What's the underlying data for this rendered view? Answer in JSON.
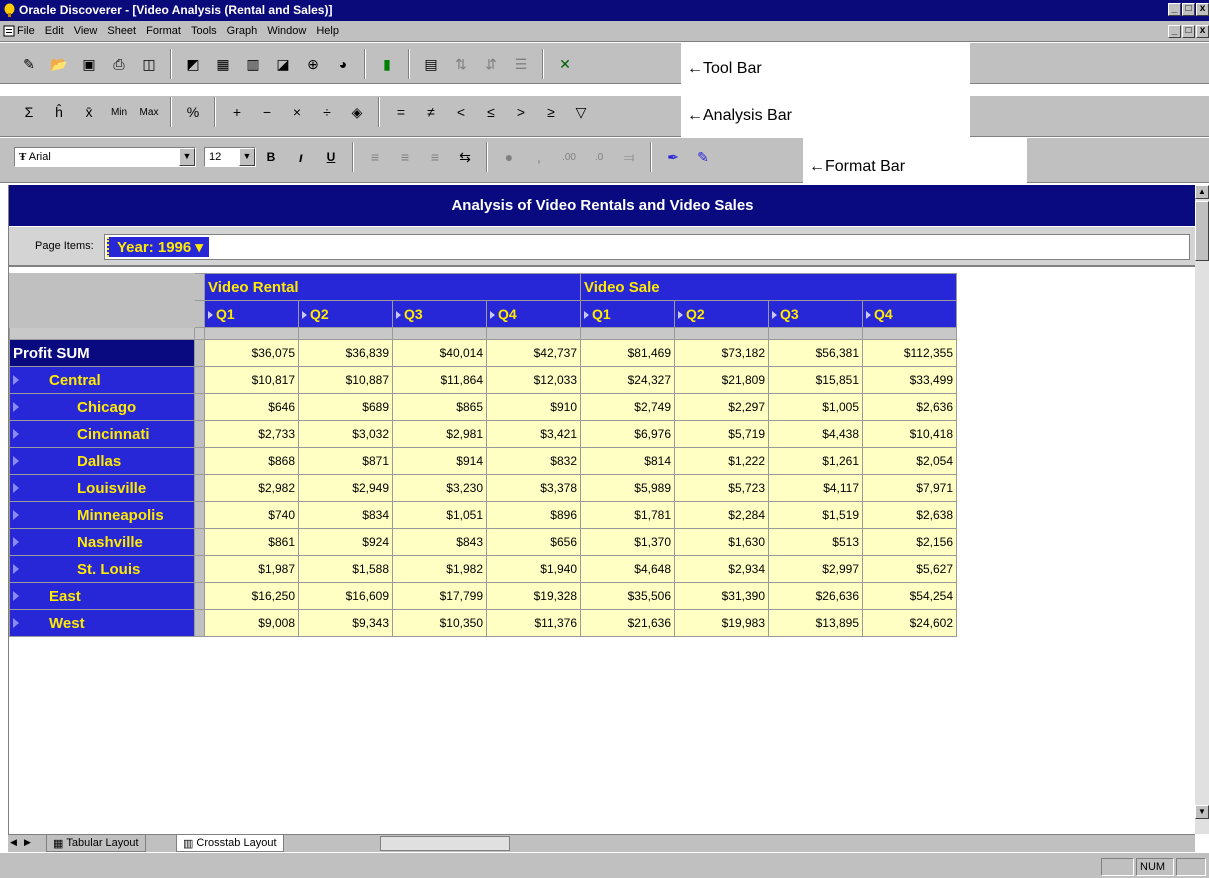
{
  "window": {
    "title": "Oracle Discoverer - [Video Analysis (Rental and Sales)]",
    "controls": [
      "_",
      "&#x25A1;",
      "x"
    ]
  },
  "menu": [
    "File",
    "Edit",
    "View",
    "Sheet",
    "Format",
    "Tools",
    "Graph",
    "Window",
    "Help"
  ],
  "callouts": {
    "toolbar": "←Tool Bar",
    "analysis": "←Analysis Bar",
    "format": "←Format Bar"
  },
  "analysis_bar": {
    "sum": "Σ",
    "count": "ĥ",
    "avg": "x̄",
    "min": "Min",
    "max": "Max",
    "pct": "%",
    "plus": "+",
    "minus": "−",
    "times": "×",
    "divide": "÷",
    "eq": "=",
    "neq": "≠",
    "lt": "<",
    "le": "≤",
    "gt": ">",
    "ge": "≥"
  },
  "format_bar": {
    "font": "Arial",
    "size": "12",
    "bold": "B",
    "italic": "ı",
    "underline": "U"
  },
  "sheet": {
    "title": "Analysis of Video Rentals and Video Sales",
    "page_items_label": "Page Items:",
    "page_item": "Year: 1996 ▾",
    "col_groups": [
      "Video Rental",
      "Video Sale"
    ],
    "quarters": [
      "Q1",
      "Q2",
      "Q3",
      "Q4",
      "Q1",
      "Q2",
      "Q3",
      "Q4"
    ],
    "rows": [
      {
        "label": "Profit SUM",
        "level": 0,
        "values": [
          "$36,075",
          "$36,839",
          "$40,014",
          "$42,737",
          "$81,469",
          "$73,182",
          "$56,381",
          "$112,355"
        ]
      },
      {
        "label": "Central",
        "level": 1,
        "values": [
          "$10,817",
          "$10,887",
          "$11,864",
          "$12,033",
          "$24,327",
          "$21,809",
          "$15,851",
          "$33,499"
        ]
      },
      {
        "label": "Chicago",
        "level": 2,
        "values": [
          "$646",
          "$689",
          "$865",
          "$910",
          "$2,749",
          "$2,297",
          "$1,005",
          "$2,636"
        ]
      },
      {
        "label": "Cincinnati",
        "level": 2,
        "values": [
          "$2,733",
          "$3,032",
          "$2,981",
          "$3,421",
          "$6,976",
          "$5,719",
          "$4,438",
          "$10,418"
        ]
      },
      {
        "label": "Dallas",
        "level": 2,
        "values": [
          "$868",
          "$871",
          "$914",
          "$832",
          "$814",
          "$1,222",
          "$1,261",
          "$2,054"
        ]
      },
      {
        "label": "Louisville",
        "level": 2,
        "values": [
          "$2,982",
          "$2,949",
          "$3,230",
          "$3,378",
          "$5,989",
          "$5,723",
          "$4,117",
          "$7,971"
        ]
      },
      {
        "label": "Minneapolis",
        "level": 2,
        "values": [
          "$740",
          "$834",
          "$1,051",
          "$896",
          "$1,781",
          "$2,284",
          "$1,519",
          "$2,638"
        ]
      },
      {
        "label": "Nashville",
        "level": 2,
        "values": [
          "$861",
          "$924",
          "$843",
          "$656",
          "$1,370",
          "$1,630",
          "$513",
          "$2,156"
        ]
      },
      {
        "label": "St. Louis",
        "level": 2,
        "values": [
          "$1,987",
          "$1,588",
          "$1,982",
          "$1,940",
          "$4,648",
          "$2,934",
          "$2,997",
          "$5,627"
        ]
      },
      {
        "label": "East",
        "level": 1,
        "values": [
          "$16,250",
          "$16,609",
          "$17,799",
          "$19,328",
          "$35,506",
          "$31,390",
          "$26,636",
          "$54,254"
        ]
      },
      {
        "label": "West",
        "level": 1,
        "values": [
          "$9,008",
          "$9,343",
          "$10,350",
          "$11,376",
          "$21,636",
          "$19,983",
          "$13,895",
          "$24,602"
        ]
      }
    ]
  },
  "tabs": [
    "Tabular Layout",
    "Crosstab Layout"
  ],
  "status": {
    "num": "NUM"
  },
  "colors": {
    "header_blue": "#2727d8",
    "title_navy": "#0a0a80",
    "header_text": "#ffea00",
    "cell_bg": "#ffffc4"
  }
}
